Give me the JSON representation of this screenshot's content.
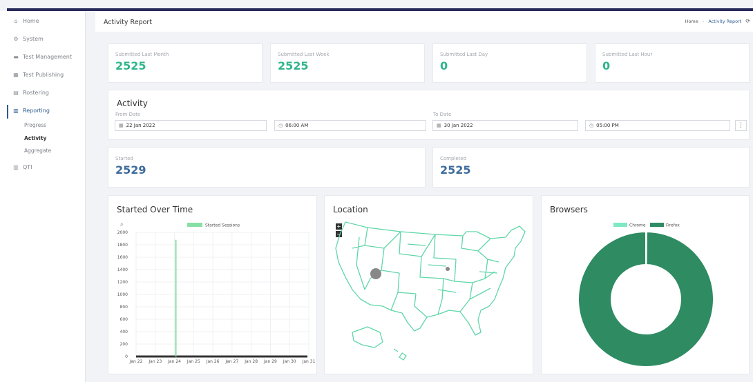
{
  "sidebar": {
    "items": [
      {
        "label": "Home",
        "icon": "home-icon",
        "glyph": "⌂"
      },
      {
        "label": "System",
        "icon": "gear-icon",
        "glyph": "⚙"
      },
      {
        "label": "Test Management",
        "icon": "folder-icon",
        "glyph": "▬"
      },
      {
        "label": "Test Publishing",
        "icon": "publish-icon",
        "glyph": "▦"
      },
      {
        "label": "Rostering",
        "icon": "roster-icon",
        "glyph": "▤"
      },
      {
        "label": "Reporting",
        "icon": "chart-icon",
        "glyph": "▥"
      },
      {
        "label": "QTI",
        "icon": "qti-icon",
        "glyph": "▥"
      }
    ],
    "reporting_sub": [
      "Progress",
      "Activity",
      "Aggregate"
    ]
  },
  "header": {
    "title": "Activity Report",
    "breadcrumb": [
      "Home",
      "Activity Report"
    ]
  },
  "stats": [
    {
      "label": "Submitted Last Month",
      "value": "2525"
    },
    {
      "label": "Submitted Last Week",
      "value": "2525"
    },
    {
      "label": "Submitted Last Day",
      "value": "0"
    },
    {
      "label": "Submitted Last Hour",
      "value": "0"
    }
  ],
  "activity": {
    "title": "Activity",
    "from_label": "From Date",
    "to_label": "To Date",
    "from_date": "22 Jan 2022",
    "from_time": "06:00 AM",
    "to_date": "30 Jan 2022",
    "to_time": "05:00 PM"
  },
  "totals": {
    "started_label": "Started",
    "started_value": "2529",
    "completed_label": "Completed",
    "completed_value": "2525"
  },
  "panels": {
    "started_over_time": "Started Over Time",
    "location": "Location",
    "browsers": "Browsers"
  },
  "colors": {
    "accent_green": "#2fb58a",
    "stat_blue": "#3e6b9b",
    "nav_active": "#2d5b8f",
    "top_bar": "#282a5c",
    "series_green": "#86e0a4",
    "firefox": "#2e8b62",
    "chrome": "#7ee8c2"
  },
  "chart_data": [
    {
      "type": "bar",
      "title": "Started Over Time",
      "series": [
        {
          "name": "Started Sessions",
          "points": [
            {
              "x": "Jan 24",
              "y": 1880
            }
          ]
        }
      ],
      "x_ticks": [
        "Jan 22",
        "Jan 23",
        "Jan 24",
        "Jan 25",
        "Jan 26",
        "Jan 27",
        "Jan 28",
        "Jan 29",
        "Jan 30",
        "Jan 31"
      ],
      "y_ticks": [
        0,
        200,
        400,
        600,
        800,
        1000,
        1200,
        1400,
        1600,
        1800,
        2000
      ],
      "ylim": [
        0,
        2000
      ],
      "grid": true,
      "legend": "top"
    },
    {
      "type": "pie",
      "title": "Browsers",
      "categories": [
        "Chrome",
        "Firefox"
      ],
      "values": [
        4,
        2525
      ],
      "legend": "top"
    }
  ],
  "map": {
    "zoom_in": "+",
    "zoom_out": "−"
  }
}
